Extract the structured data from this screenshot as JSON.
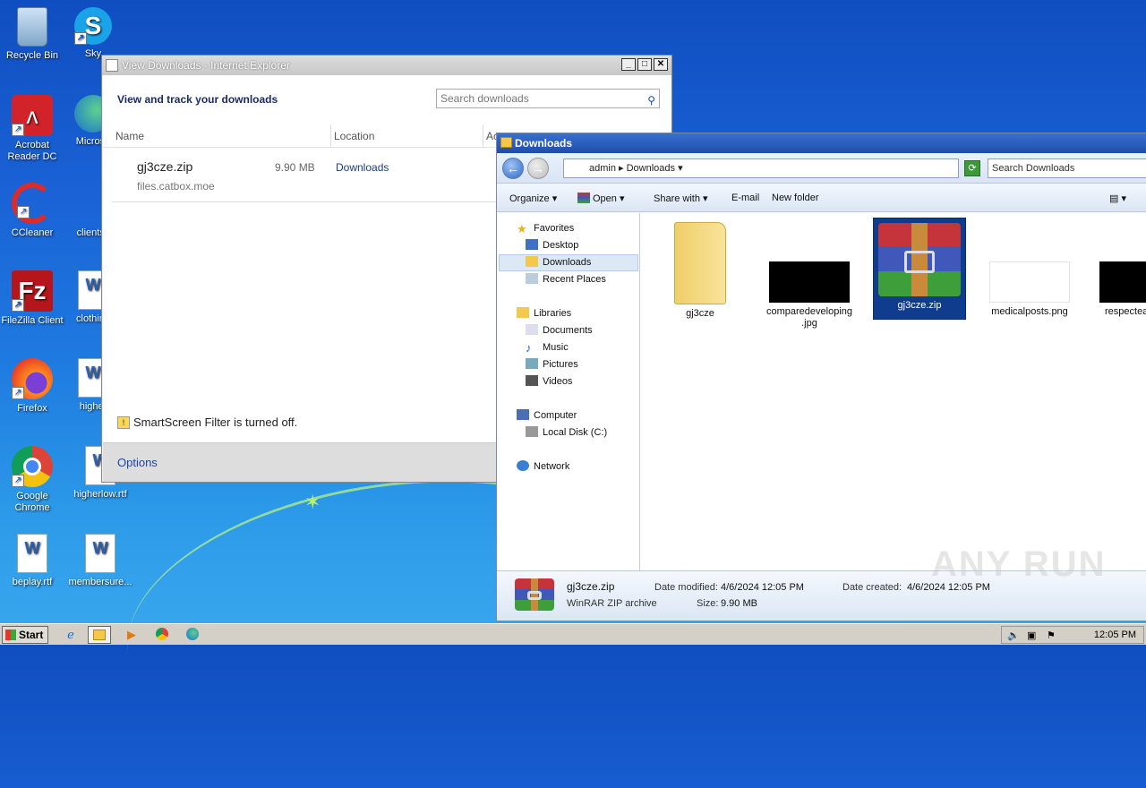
{
  "desktop": {
    "icons": [
      {
        "label": "Recycle Bin"
      },
      {
        "label": "Sky"
      },
      {
        "label": "Acrobat Reader DC"
      },
      {
        "label": "Microso"
      },
      {
        "label": "CCleaner"
      },
      {
        "label": "clientsc"
      },
      {
        "label": "FileZilla Client"
      },
      {
        "label": "clothing"
      },
      {
        "label": "Firefox"
      },
      {
        "label": "higher"
      },
      {
        "label": "Google Chrome"
      },
      {
        "label": "higherlow.rtf"
      },
      {
        "label": "beplay.rtf"
      },
      {
        "label": "membersure..."
      }
    ]
  },
  "ie_window": {
    "title": "View Downloads - Internet Explorer",
    "heading": "View and track your downloads",
    "search_placeholder": "Search downloads",
    "columns": {
      "name": "Name",
      "location": "Location",
      "actions": "Ac"
    },
    "download": {
      "file": "gj3cze.zip",
      "source": "files.catbox.moe",
      "size": "9.90 MB",
      "location": "Downloads"
    },
    "smartscreen": "SmartScreen Filter is turned off.",
    "options": "Options"
  },
  "explorer": {
    "title": "Downloads",
    "breadcrumb": [
      "admin",
      "Downloads"
    ],
    "search_placeholder": "Search Downloads",
    "commands": {
      "organize": "Organize",
      "open": "Open",
      "share": "Share with",
      "email": "E-mail",
      "new_folder": "New folder"
    },
    "nav": {
      "favorites": "Favorites",
      "desktop": "Desktop",
      "downloads": "Downloads",
      "recent": "Recent Places",
      "libraries": "Libraries",
      "documents": "Documents",
      "music": "Music",
      "pictures": "Pictures",
      "videos": "Videos",
      "computer": "Computer",
      "local_disk": "Local Disk (C:)",
      "network": "Network"
    },
    "files": [
      {
        "name": "gj3cze"
      },
      {
        "name": "comparedeveloping .jpg"
      },
      {
        "name": "gj3cze.zip"
      },
      {
        "name": "medicalposts.png"
      },
      {
        "name": "respectea"
      }
    ],
    "details": {
      "name": "gj3cze.zip",
      "type": "WinRAR ZIP archive",
      "modified_label": "Date modified:",
      "modified": "4/6/2024 12:05 PM",
      "size_label": "Size:",
      "size": "9.90 MB",
      "created_label": "Date created:",
      "created": "4/6/2024 12:05 PM"
    }
  },
  "taskbar": {
    "start": "Start",
    "clock": "12:05 PM"
  },
  "watermark": "ANY RUN"
}
